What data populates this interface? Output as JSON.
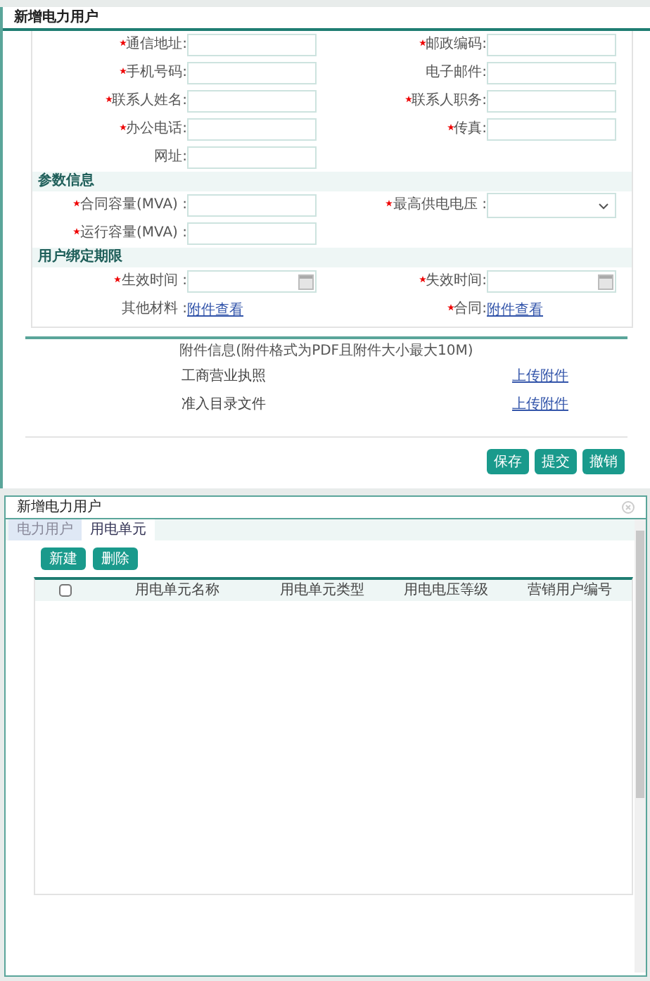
{
  "top_dialog": {
    "title": "新增电力用户",
    "sections": [
      {
        "rows": [
          [
            {
              "label": "通信地址:",
              "required": true,
              "kind": "text"
            },
            {
              "label": "邮政编码:",
              "required": true,
              "kind": "text"
            }
          ],
          [
            {
              "label": "手机号码:",
              "required": true,
              "kind": "text"
            },
            {
              "label": "电子邮件:",
              "required": false,
              "kind": "text"
            }
          ],
          [
            {
              "label": "联系人姓名:",
              "required": true,
              "kind": "text"
            },
            {
              "label": "联系人职务:",
              "required": true,
              "kind": "text"
            }
          ],
          [
            {
              "label": "办公电话:",
              "required": true,
              "kind": "text"
            },
            {
              "label": "传真:",
              "required": true,
              "kind": "text"
            }
          ],
          [
            {
              "label": "网址:",
              "required": false,
              "kind": "text"
            }
          ]
        ]
      },
      {
        "heading": "参数信息",
        "rows": [
          [
            {
              "label": "合同容量(MVA) :",
              "required": true,
              "kind": "text"
            },
            {
              "label": "最高供电电压 :",
              "required": true,
              "kind": "select"
            }
          ],
          [
            {
              "label": "运行容量(MVA) :",
              "required": true,
              "kind": "text"
            }
          ]
        ]
      },
      {
        "heading": "用户绑定期限",
        "rows": [
          [
            {
              "label": "生效时间 :",
              "required": true,
              "kind": "date"
            },
            {
              "label": "失效时间:",
              "required": true,
              "kind": "date"
            }
          ],
          [
            {
              "label": "其他材料 :",
              "required": false,
              "kind": "link",
              "link": "附件查看"
            },
            {
              "label": "合同:",
              "required": true,
              "kind": "link",
              "link": "附件查看"
            }
          ]
        ]
      }
    ],
    "attachments": {
      "title": "附件信息(附件格式为PDF且附件大小最大10M)",
      "items": [
        {
          "name": "工商营业执照",
          "link": "上传附件"
        },
        {
          "name": "准入目录文件",
          "link": "上传附件"
        }
      ]
    },
    "buttons": [
      "保存",
      "提交",
      "撤销"
    ]
  },
  "bottom_dialog": {
    "title": "新增电力用户",
    "tabs": [
      {
        "label": "电力用户",
        "selected": false
      },
      {
        "label": "用电单元",
        "selected": true
      }
    ],
    "buttons": [
      "新建",
      "删除"
    ],
    "table": {
      "select_all_checked": false,
      "columns": [
        "用电单元名称",
        "用电单元类型",
        "用电电压等级",
        "营销用户编号"
      ]
    }
  }
}
